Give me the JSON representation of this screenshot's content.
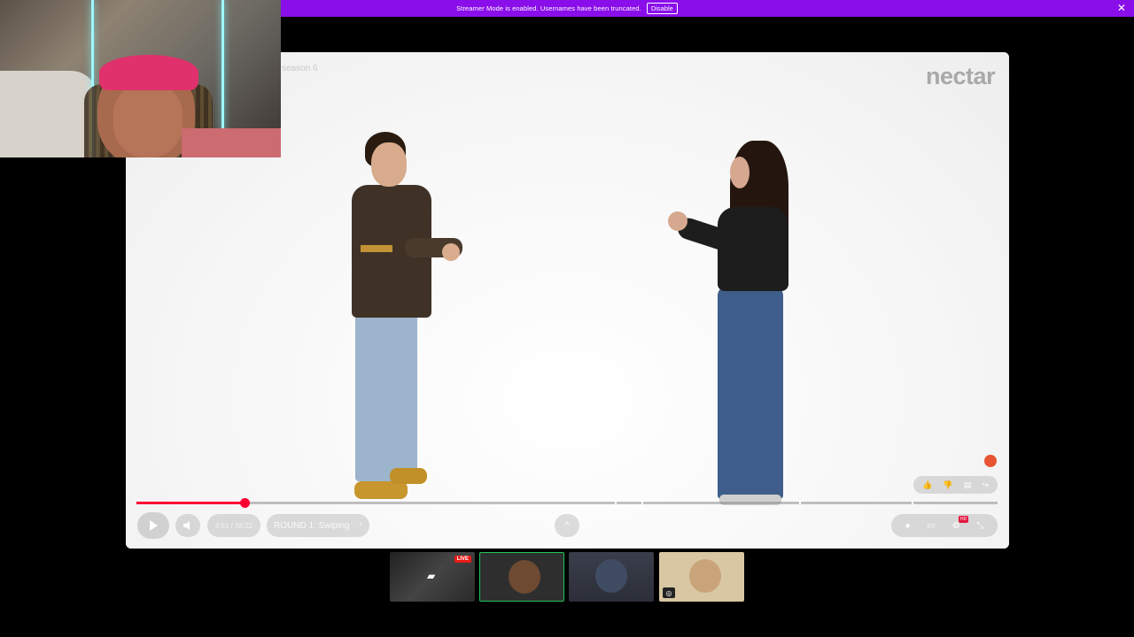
{
  "banner": {
    "message": "Streamer Mode is enabled. Usernames have been truncated.",
    "disable_label": "Disable",
    "close_glyph": "✕",
    "color": "#8a0eea"
  },
  "video": {
    "title": "season 6",
    "brand": "nectar",
    "progress_fraction": 0.125,
    "time_current": "4:51",
    "time_total": "/ 38:22",
    "chapter": "ROUND 1: Swiping",
    "accent_color": "#ff0033"
  },
  "icons": {
    "play": "play-icon",
    "volume": "volume-icon",
    "chevron_right": "›",
    "chevron_up": "^",
    "like": "👍",
    "dislike": "👎",
    "comment": "▤",
    "share": "↪",
    "toggle": "●",
    "captions": "▭",
    "settings": "⚙",
    "exit": "⤡"
  },
  "hd_badge": "HD",
  "thumbnails": {
    "live_badge": "LIVE"
  }
}
